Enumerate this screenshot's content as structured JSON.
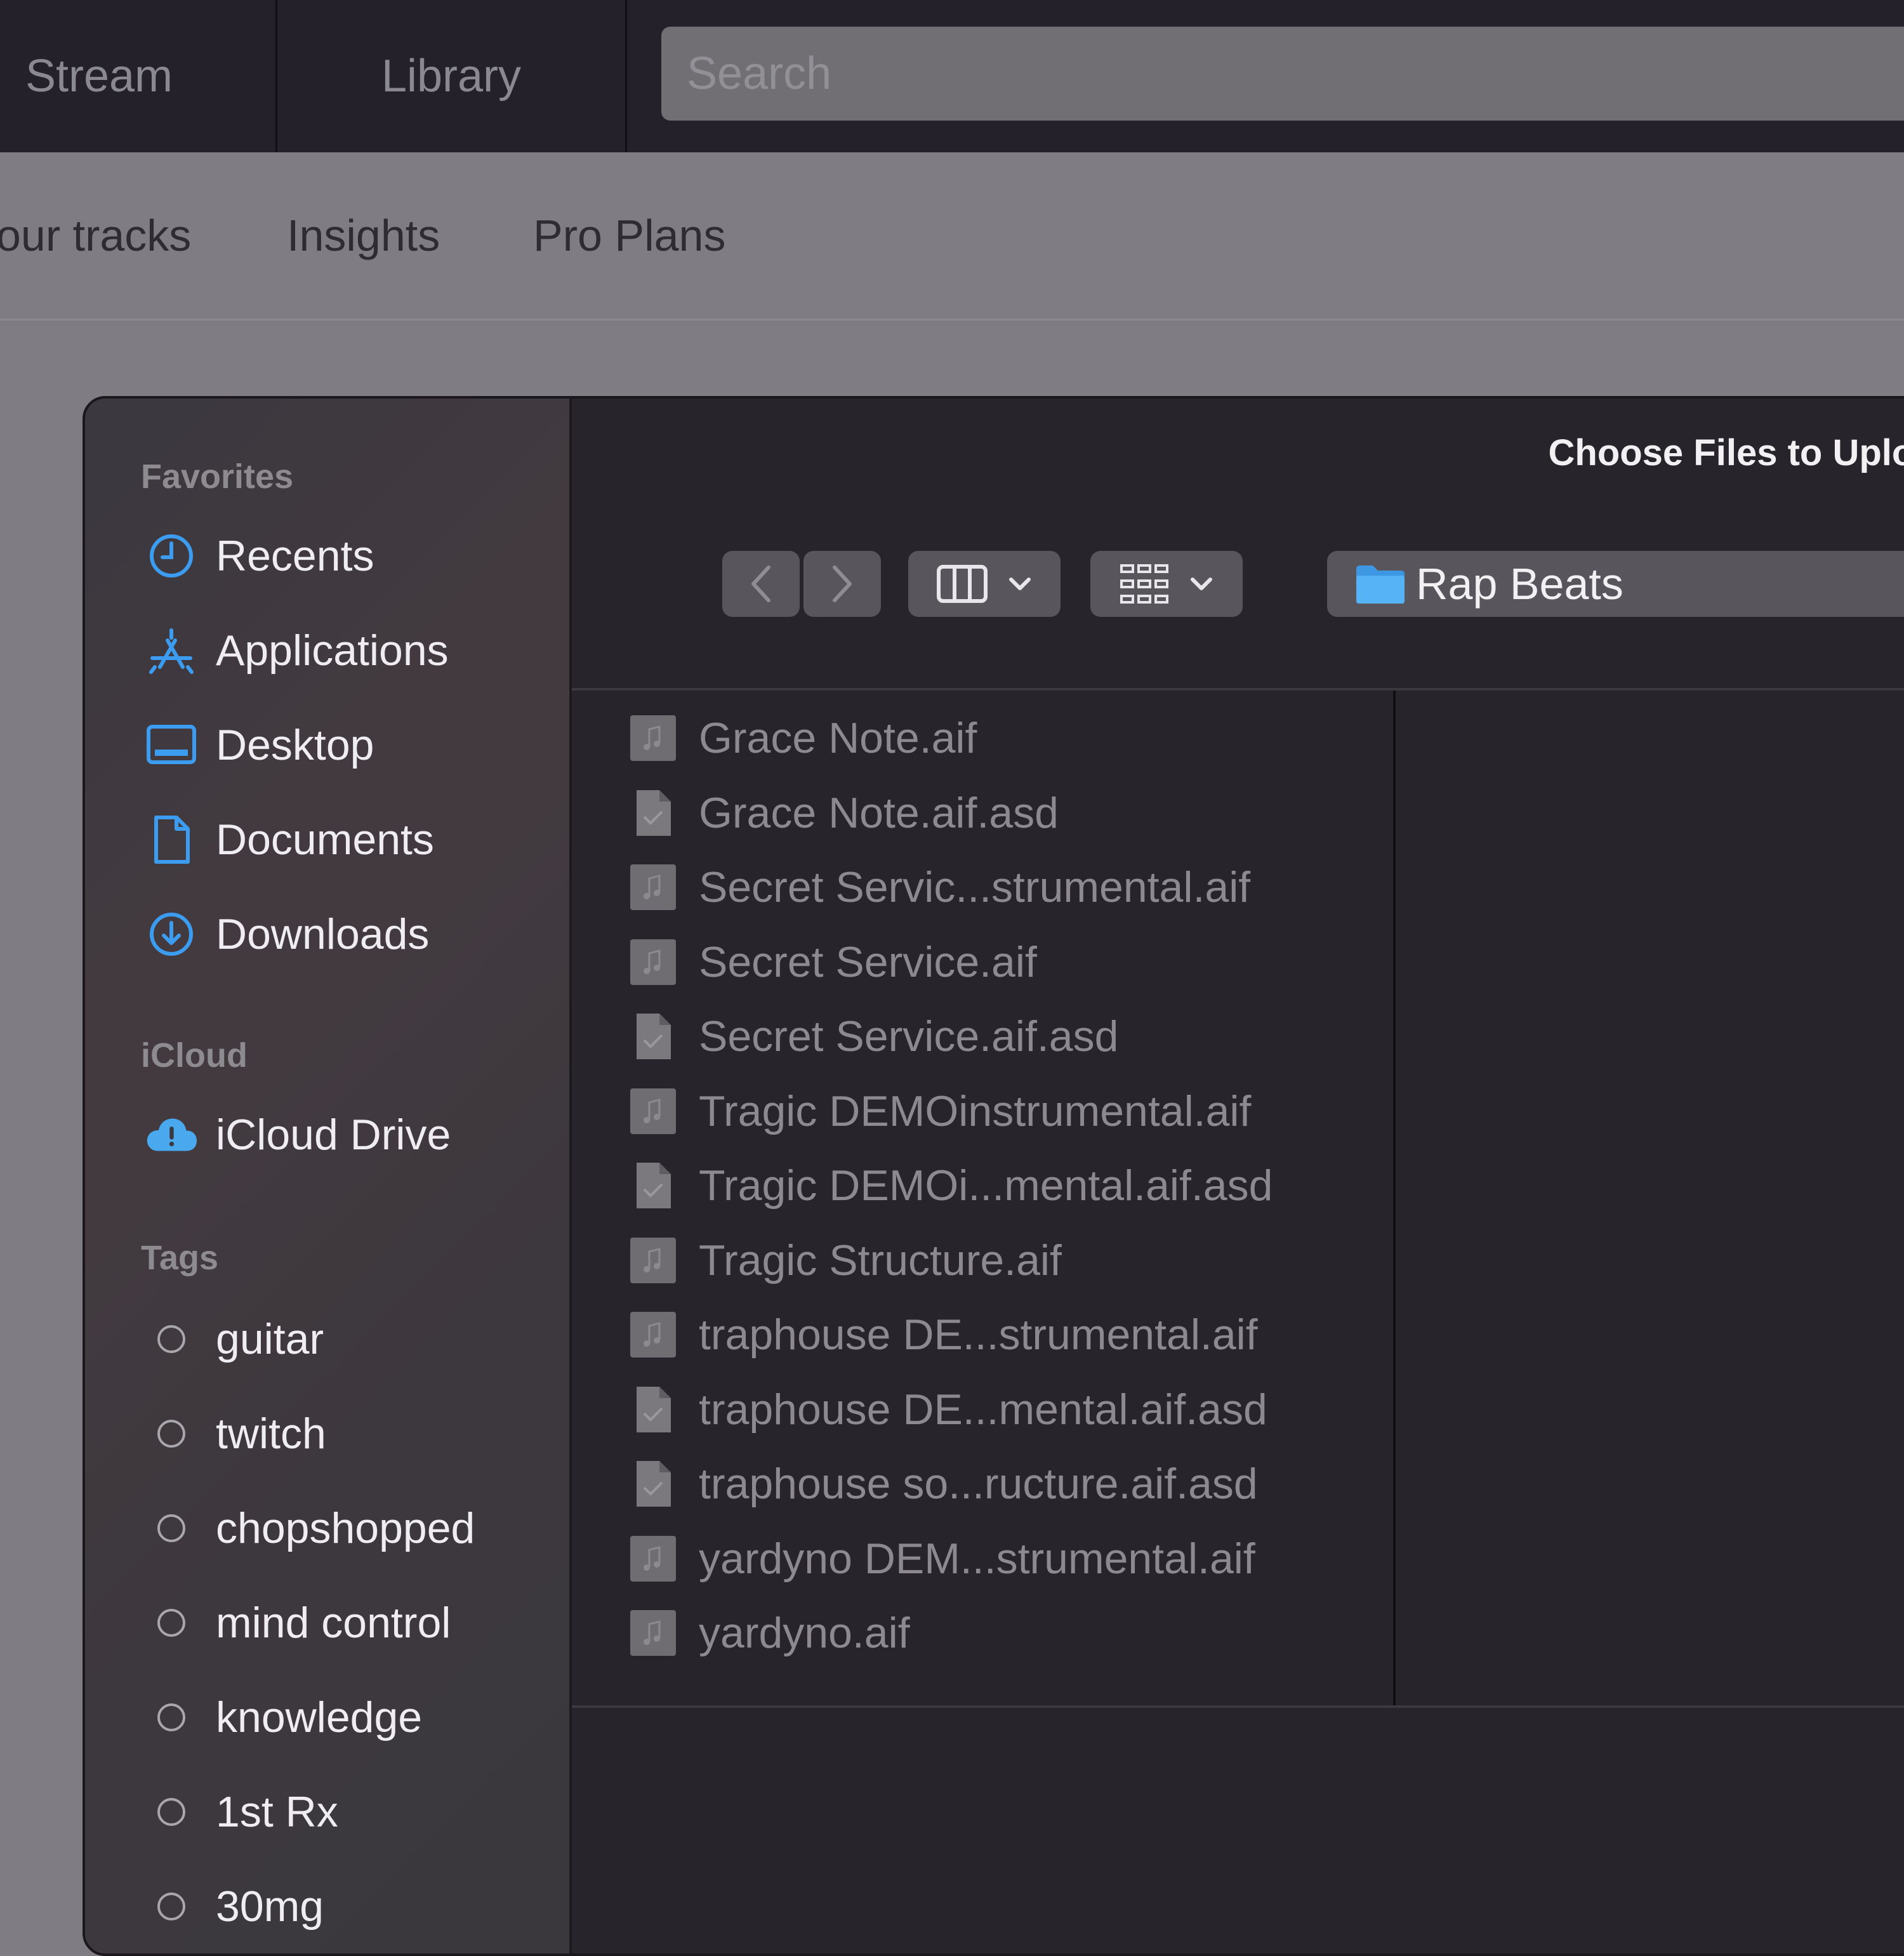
{
  "topnav": {
    "tabs": [
      "Stream",
      "Library"
    ],
    "search_placeholder": "Search"
  },
  "subnav": {
    "items": [
      "our tracks",
      "Insights",
      "Pro Plans"
    ]
  },
  "dialog": {
    "title": "Choose Files to Upload",
    "location": "Rap Beats",
    "sidebar": {
      "favorites_title": "Favorites",
      "favorites": [
        {
          "label": "Recents",
          "icon": "clock-icon"
        },
        {
          "label": "Applications",
          "icon": "applications-icon"
        },
        {
          "label": "Desktop",
          "icon": "desktop-icon"
        },
        {
          "label": "Documents",
          "icon": "document-icon"
        },
        {
          "label": "Downloads",
          "icon": "download-icon"
        }
      ],
      "icloud_title": "iCloud",
      "icloud": [
        {
          "label": "iCloud Drive",
          "icon": "icloud-warning-icon"
        }
      ],
      "tags_title": "Tags",
      "tags": [
        "guitar",
        "twitch",
        "chopshopped",
        "mind control",
        "knowledge",
        "1st Rx",
        "30mg"
      ]
    },
    "files": [
      {
        "name": "Grace Note.aif",
        "kind": "audio"
      },
      {
        "name": "Grace Note.aif.asd",
        "kind": "doc"
      },
      {
        "name": "Secret Servic...strumental.aif",
        "kind": "audio"
      },
      {
        "name": "Secret Service.aif",
        "kind": "audio"
      },
      {
        "name": "Secret Service.aif.asd",
        "kind": "doc"
      },
      {
        "name": "Tragic DEMOinstrumental.aif",
        "kind": "audio"
      },
      {
        "name": "Tragic DEMOi...mental.aif.asd",
        "kind": "doc"
      },
      {
        "name": "Tragic Structure.aif",
        "kind": "audio"
      },
      {
        "name": "traphouse DE...strumental.aif",
        "kind": "audio"
      },
      {
        "name": "traphouse DE...mental.aif.asd",
        "kind": "doc"
      },
      {
        "name": "traphouse so...ructure.aif.asd",
        "kind": "doc"
      },
      {
        "name": "yardyno DEM...strumental.aif",
        "kind": "audio"
      },
      {
        "name": "yardyno.aif",
        "kind": "audio"
      }
    ]
  },
  "colors": {
    "accent": "#3b9cf0",
    "folder": "#4aa8ef"
  }
}
